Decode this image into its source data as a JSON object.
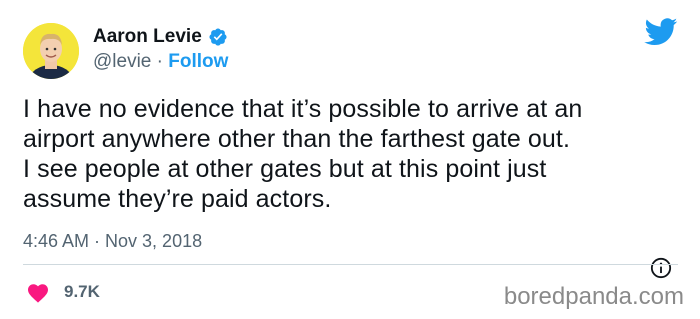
{
  "author": {
    "name": "Aaron Levie",
    "handle": "@levie",
    "separator": "·",
    "follow_label": "Follow"
  },
  "tweet": {
    "text": "I have no evidence that it’s possible to arrive at an\nairport anywhere other than the farthest gate out.\nI see people at other gates but at this point just\nassume they’re paid actors.",
    "timestamp": "4:46 AM · Nov 3, 2018",
    "likes": "9.7K"
  },
  "icons": {
    "verified": "verified-badge-icon",
    "twitter": "twitter-bird-icon",
    "info": "info-icon",
    "like": "heart-icon"
  },
  "colors": {
    "accent": "#1d9bf0",
    "heart": "#f91880",
    "secondary_text": "#536471"
  },
  "watermark": "boredpanda.com"
}
